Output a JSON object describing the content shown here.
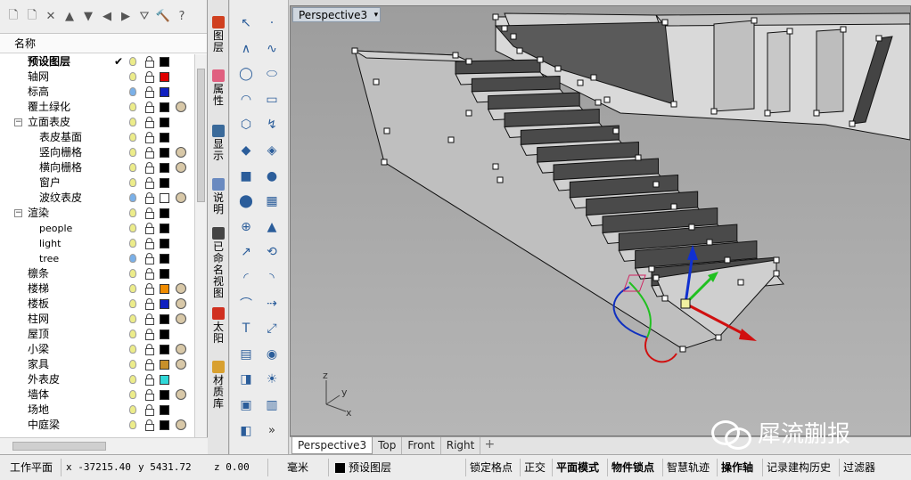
{
  "layers_panel": {
    "column_header": "名称",
    "toolbar_icons": [
      "new-document-icon",
      "new-layer-icon",
      "delete-icon",
      "move-up-icon",
      "move-down-icon",
      "back-arrow-icon",
      "forward-arrow-icon",
      "filter-icon",
      "tools-icon",
      "help-icon"
    ],
    "layers": [
      {
        "name": "预设图层",
        "indent": 1,
        "bold": true,
        "current": true,
        "check": "✔",
        "bulb": "yellow",
        "color": "#000000",
        "material": false
      },
      {
        "name": "轴网",
        "indent": 0,
        "bulb": "yellow",
        "color": "#e00000",
        "material": false
      },
      {
        "name": "标高",
        "indent": 0,
        "bulb": "blue",
        "color": "#1020c0",
        "material": false
      },
      {
        "name": "覆土绿化",
        "indent": 0,
        "bulb": "yellow",
        "color": "#000000",
        "material": true
      },
      {
        "name": "立面表皮",
        "indent": 0,
        "expand": "−",
        "bulb": "yellow",
        "color": "#000000",
        "material": false
      },
      {
        "name": "表皮基面",
        "indent": 2,
        "bulb": "yellow",
        "color": "#000000",
        "material": false
      },
      {
        "name": "竖向栅格",
        "indent": 2,
        "bulb": "yellow",
        "color": "#000000",
        "material": true
      },
      {
        "name": "横向栅格",
        "indent": 2,
        "bulb": "yellow",
        "color": "#000000",
        "material": true
      },
      {
        "name": "窗户",
        "indent": 2,
        "bulb": "yellow",
        "color": "#000000",
        "material": false
      },
      {
        "name": "波纹表皮",
        "indent": 2,
        "bulb": "blue",
        "color": "#ffffff",
        "material": true
      },
      {
        "name": "渲染",
        "indent": 0,
        "expand": "−",
        "bulb": "yellow",
        "color": "#000000",
        "material": false
      },
      {
        "name": "people",
        "indent": 2,
        "small": true,
        "bulb": "yellow",
        "color": "#000000",
        "material": false
      },
      {
        "name": "light",
        "indent": 2,
        "small": true,
        "bulb": "yellow",
        "color": "#000000",
        "material": false
      },
      {
        "name": "tree",
        "indent": 2,
        "small": true,
        "bulb": "blue",
        "color": "#000000",
        "material": false
      },
      {
        "name": "檩条",
        "indent": 0,
        "bulb": "yellow",
        "color": "#000000",
        "material": false
      },
      {
        "name": "楼梯",
        "indent": 0,
        "bulb": "yellow",
        "color": "#f08c00",
        "material": true
      },
      {
        "name": "楼板",
        "indent": 0,
        "bulb": "yellow",
        "color": "#1020c0",
        "material": true
      },
      {
        "name": "柱网",
        "indent": 0,
        "bulb": "yellow",
        "color": "#000000",
        "material": true
      },
      {
        "name": "屋顶",
        "indent": 0,
        "bulb": "yellow",
        "color": "#000000",
        "material": false
      },
      {
        "name": "小梁",
        "indent": 0,
        "bulb": "yellow",
        "color": "#000000",
        "material": true
      },
      {
        "name": "家具",
        "indent": 0,
        "bulb": "yellow",
        "color": "#c8902a",
        "material": true
      },
      {
        "name": "外表皮",
        "indent": 0,
        "bulb": "yellow",
        "color": "#30d8d8",
        "material": false
      },
      {
        "name": "墙体",
        "indent": 0,
        "bulb": "yellow",
        "color": "#000000",
        "material": true
      },
      {
        "name": "场地",
        "indent": 0,
        "bulb": "yellow",
        "color": "#000000",
        "material": false
      },
      {
        "name": "中庭梁",
        "indent": 0,
        "bulb": "yellow",
        "color": "#000000",
        "material": true
      }
    ]
  },
  "side_tabs": [
    {
      "label": "图层",
      "icon_color": "#d04020"
    },
    {
      "label": "属性",
      "icon_color": "#e06080"
    },
    {
      "label": "显示",
      "icon_color": "#3a6a9a"
    },
    {
      "label": "说明",
      "icon_color": "#6a8ac0"
    },
    {
      "label": "已命名视图",
      "icon_color": "#444444"
    },
    {
      "label": "太阳",
      "icon_color": "#d03020"
    },
    {
      "label": "材质库",
      "icon_color": "#d8a030"
    }
  ],
  "tool_icons": [
    "select-arrow-icon",
    "point-icon",
    "polyline-icon",
    "control-point-curve-icon",
    "circle-icon",
    "ellipse-icon",
    "arc-icon",
    "rectangle-icon",
    "polygon-icon",
    "curve-tools-icon",
    "surface-plane-icon",
    "surface-tools-icon",
    "box-solid-icon",
    "sphere-solid-icon",
    "cylinder-solid-icon",
    "mesh-icon",
    "boolean-icon",
    "rendering-icon",
    "transform-icon",
    "analysis-icon",
    "dimension-icon",
    "arc-tool-icon",
    "fillet-icon",
    "extend-icon",
    "text-icon",
    "scale-icon",
    "array-icon",
    "group-icon",
    "solid-edit-icon",
    "lighting-icon",
    "block-icon",
    "layout-icon",
    "display-mode-icon",
    "more-icon"
  ],
  "viewport": {
    "title": "Perspective3",
    "axis_labels": {
      "x": "x",
      "y": "y",
      "z": "z"
    },
    "tabs": [
      "Perspective3",
      "Top",
      "Front",
      "Right"
    ],
    "active_tab": "Perspective3",
    "add_tab": "+"
  },
  "watermark": {
    "text": "犀流蒯报"
  },
  "status_bar": {
    "cplane": "工作平面",
    "x": "x -37215.40",
    "y": "y 5431.72",
    "z": "z 0.00",
    "units": "毫米",
    "layer": "预设图层",
    "toggles": [
      {
        "label": "锁定格点",
        "bold": false
      },
      {
        "label": "正交",
        "bold": false
      },
      {
        "label": "平面模式",
        "bold": true
      },
      {
        "label": "物件锁点",
        "bold": true
      },
      {
        "label": "智慧轨迹",
        "bold": false
      },
      {
        "label": "操作轴",
        "bold": true
      },
      {
        "label": "记录建构历史",
        "bold": false
      },
      {
        "label": "过滤器",
        "bold": false
      }
    ]
  }
}
